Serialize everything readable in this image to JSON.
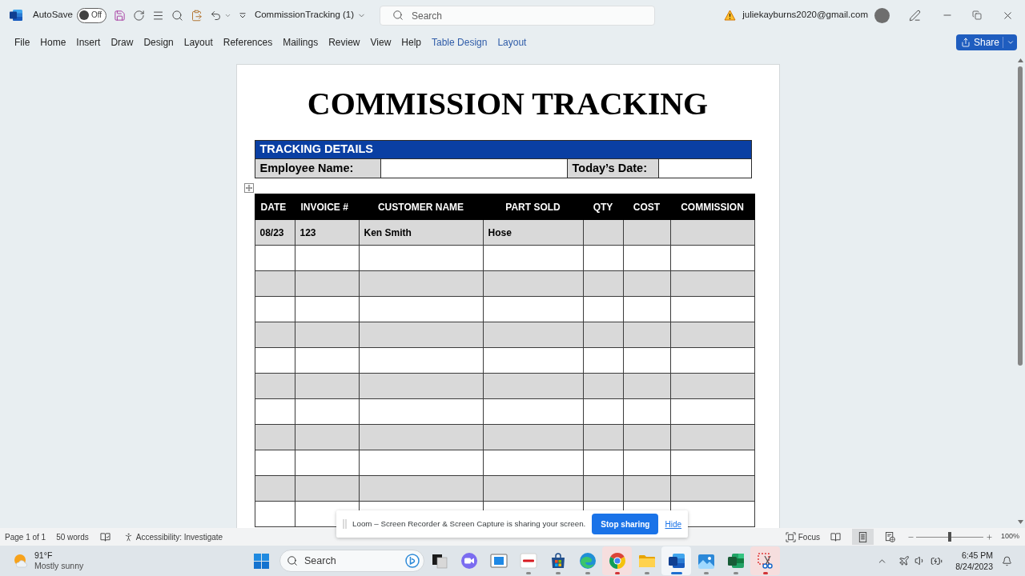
{
  "title_bar": {
    "autosave_label": "AutoSave",
    "autosave": {
      "on": false,
      "label": "Off"
    },
    "document_title": "CommissionTracking (1)",
    "search": {
      "placeholder": "Search"
    },
    "account": "juliekayburns2020@gmail.com"
  },
  "ribbon_tabs": [
    {
      "label": "File",
      "contextual": false
    },
    {
      "label": "Home",
      "contextual": false
    },
    {
      "label": "Insert",
      "contextual": false
    },
    {
      "label": "Draw",
      "contextual": false
    },
    {
      "label": "Design",
      "contextual": false
    },
    {
      "label": "Layout",
      "contextual": false
    },
    {
      "label": "References",
      "contextual": false
    },
    {
      "label": "Mailings",
      "contextual": false
    },
    {
      "label": "Review",
      "contextual": false
    },
    {
      "label": "View",
      "contextual": false
    },
    {
      "label": "Help",
      "contextual": false
    },
    {
      "label": "Table Design",
      "contextual": true
    },
    {
      "label": "Layout",
      "contextual": true
    }
  ],
  "share_button": {
    "label": "Share"
  },
  "document": {
    "title": "COMMISSION TRACKING",
    "details": {
      "heading": "TRACKING DETAILS",
      "fields": [
        {
          "label": "Employee Name:"
        },
        {
          "label": "Today’s Date:"
        }
      ]
    },
    "table": {
      "columns": [
        "DATE",
        "INVOICE #",
        "CUSTOMER NAME",
        "PART SOLD",
        "QTY",
        "COST",
        "COMMISSION"
      ],
      "rows": [
        {
          "cells": [
            "08/23",
            "123",
            "Ken Smith",
            "Hose"
          ]
        }
      ]
    }
  },
  "sharing_banner": {
    "message": "Loom – Screen Recorder & Screen Capture is sharing your screen.",
    "stop_button": "Stop sharing",
    "hide_link": "Hide"
  },
  "status_bar": {
    "page": "Page 1 of 1",
    "words": "50 words",
    "accessibility": "Accessibility: Investigate",
    "focus": "Focus",
    "views": [
      {
        "kind": "read",
        "selected": false
      },
      {
        "kind": "print",
        "selected": true
      },
      {
        "kind": "web",
        "selected": false
      }
    ],
    "zoom": {
      "level": 0.5,
      "reading": "100%"
    }
  },
  "taskbar": {
    "weather": {
      "temperature": "91°F",
      "condition": "Mostly sunny"
    },
    "search": {
      "placeholder": "Search"
    },
    "apps": [
      {
        "kind": "task-view",
        "running": false,
        "selected": false,
        "alert": false
      },
      {
        "kind": "video-chat",
        "running": false,
        "selected": false,
        "alert": false
      },
      {
        "kind": "window",
        "running": false,
        "selected": false,
        "alert": false
      },
      {
        "kind": "logo-tile",
        "running": true,
        "selected": false,
        "alert": false
      },
      {
        "kind": "store",
        "running": true,
        "selected": false,
        "alert": false
      },
      {
        "kind": "swirl-browser",
        "running": true,
        "selected": false,
        "alert": false
      },
      {
        "kind": "ring-browser",
        "running": true,
        "selected": false,
        "alert": true
      },
      {
        "kind": "folder",
        "running": true,
        "selected": false,
        "alert": false
      },
      {
        "kind": "document",
        "running": true,
        "selected": true,
        "alert": false
      },
      {
        "kind": "photos",
        "running": true,
        "selected": false,
        "alert": false
      },
      {
        "kind": "spreadsheet",
        "running": true,
        "selected": false,
        "alert": false
      },
      {
        "kind": "snipping",
        "running": true,
        "selected": false,
        "alert": true
      }
    ],
    "clock": {
      "time": "6:45 PM",
      "date": "8/24/2023"
    }
  }
}
